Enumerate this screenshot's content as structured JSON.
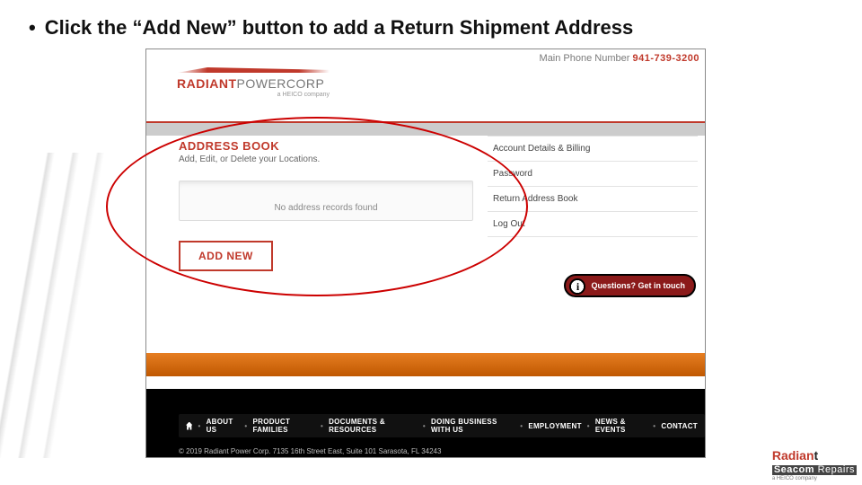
{
  "instruction_text": "Click the “Add New” button to add a Return Shipment Address",
  "header": {
    "logo_primary": "RADIANT",
    "logo_secondary": "POWERCORP",
    "logo_subtitle": "a HEICO company",
    "phone_label": "Main Phone Number ",
    "phone_number": "941-739-3200"
  },
  "address_panel": {
    "title": "ADDRESS BOOK",
    "subtitle": "Add, Edit, or Delete your Locations.",
    "empty_message": "No address records found",
    "add_button": "ADD NEW"
  },
  "side_menu": [
    "Account Details & Billing",
    "Password",
    "Return Address Book",
    "Log Out"
  ],
  "contact_bubble": "Questions? Get in touch",
  "footer_nav": {
    "items": [
      "ABOUT US",
      "PRODUCT FAMILIES",
      "DOCUMENTS & RESOURCES",
      "DOING BUSINESS WITH US",
      "EMPLOYMENT",
      "NEWS & EVENTS",
      "CONTACT"
    ]
  },
  "copyright": "© 2019 Radiant Power Corp.   7135 16th Street East, Suite 101 Sarasota, FL 34243",
  "seacom": {
    "line1a": "Radian",
    "line1b": "t",
    "line2a": "Seacom",
    "line2b": " Repairs",
    "sub": "a HEICO company"
  }
}
